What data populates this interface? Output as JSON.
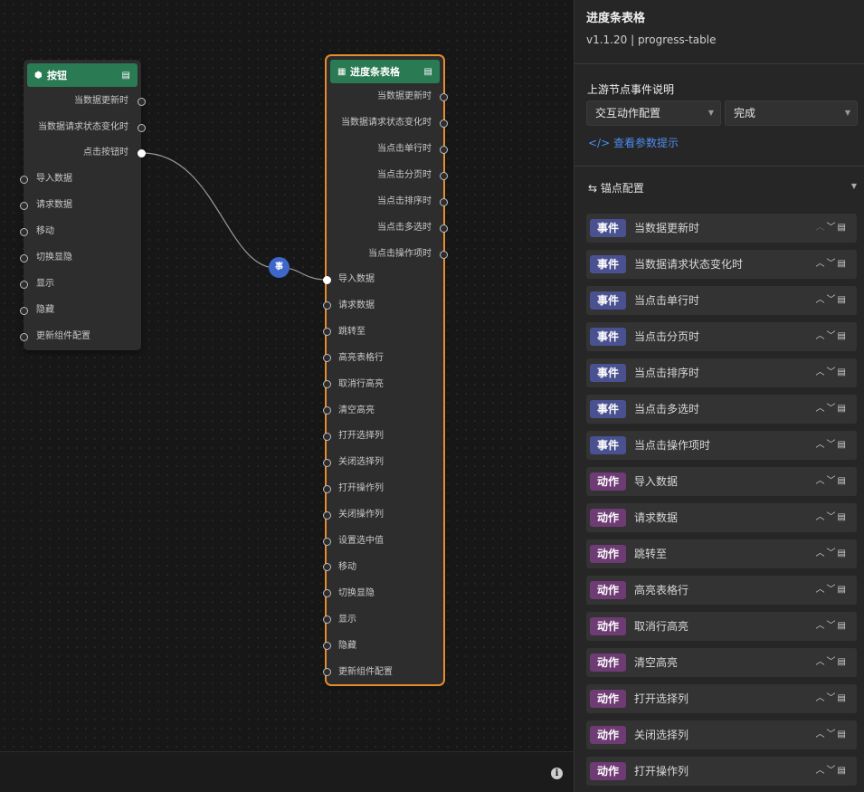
{
  "canvas": {
    "mid_badge": "事",
    "button_node": {
      "title": "按钮",
      "outputs": [
        "当数据更新时",
        "当数据请求状态变化时",
        "点击按钮时"
      ],
      "inputs": [
        "导入数据",
        "请求数据",
        "移动",
        "切换显隐",
        "显示",
        "隐藏",
        "更新组件配置"
      ]
    },
    "table_node": {
      "title": "进度条表格",
      "outputs": [
        "当数据更新时",
        "当数据请求状态变化时",
        "当点击单行时",
        "当点击分页时",
        "当点击排序时",
        "当点击多选时",
        "当点击操作项时"
      ],
      "inputs": [
        "导入数据",
        "请求数据",
        "跳转至",
        "高亮表格行",
        "取消行高亮",
        "清空高亮",
        "打开选择列",
        "关闭选择列",
        "打开操作列",
        "关闭操作列",
        "设置选中值",
        "移动",
        "切换显隐",
        "显示",
        "隐藏",
        "更新组件配置"
      ]
    }
  },
  "panel": {
    "title": "进度条表格",
    "version": "v1.1.20 | progress-table",
    "upstream_label": "上游节点事件说明",
    "select_left": "交互动作配置",
    "select_right": "完成",
    "link": "</> 查看参数提示",
    "section": "⇆  锚点配置",
    "rows": [
      {
        "tag": "事件",
        "type": "event",
        "label": "当数据更新时"
      },
      {
        "tag": "事件",
        "type": "event",
        "label": "当数据请求状态变化时"
      },
      {
        "tag": "事件",
        "type": "event",
        "label": "当点击单行时"
      },
      {
        "tag": "事件",
        "type": "event",
        "label": "当点击分页时"
      },
      {
        "tag": "事件",
        "type": "event",
        "label": "当点击排序时"
      },
      {
        "tag": "事件",
        "type": "event",
        "label": "当点击多选时"
      },
      {
        "tag": "事件",
        "type": "event",
        "label": "当点击操作项时"
      },
      {
        "tag": "动作",
        "type": "action",
        "label": "导入数据"
      },
      {
        "tag": "动作",
        "type": "action",
        "label": "请求数据"
      },
      {
        "tag": "动作",
        "type": "action",
        "label": "跳转至"
      },
      {
        "tag": "动作",
        "type": "action",
        "label": "高亮表格行"
      },
      {
        "tag": "动作",
        "type": "action",
        "label": "取消行高亮"
      },
      {
        "tag": "动作",
        "type": "action",
        "label": "清空高亮"
      },
      {
        "tag": "动作",
        "type": "action",
        "label": "打开选择列"
      },
      {
        "tag": "动作",
        "type": "action",
        "label": "关闭选择列"
      },
      {
        "tag": "动作",
        "type": "action",
        "label": "打开操作列"
      }
    ]
  }
}
